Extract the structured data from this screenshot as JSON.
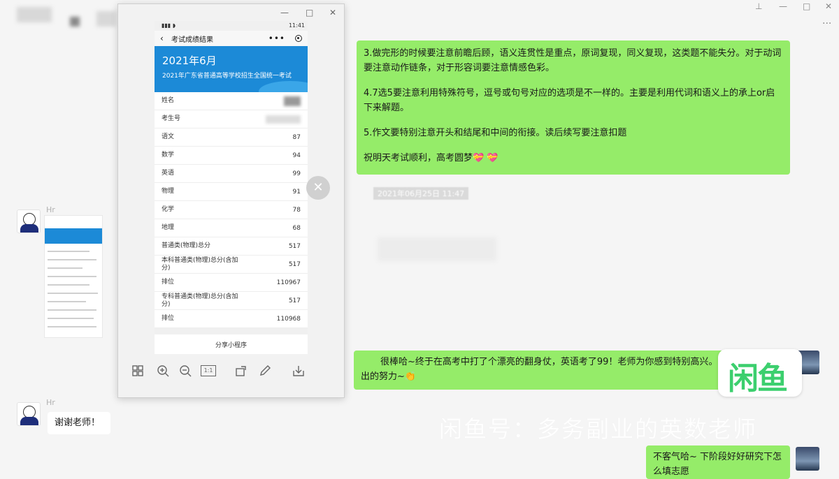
{
  "window": {
    "controls": [
      "—",
      "□",
      "✕"
    ]
  },
  "viewer": {
    "controls": [
      "—",
      "□",
      "✕"
    ],
    "phone": {
      "status_time": "11:41",
      "nav_title": "考试成绩结果",
      "banner_year": "2021年6月",
      "banner_subtitle": "2021年广东省普通高等学校招生全国统一考试",
      "rows": [
        {
          "label": "姓名",
          "value": ""
        },
        {
          "label": "考生号",
          "value": ""
        },
        {
          "label": "语文",
          "value": "87"
        },
        {
          "label": "数学",
          "value": "94"
        },
        {
          "label": "英语",
          "value": "99"
        },
        {
          "label": "物理",
          "value": "91"
        },
        {
          "label": "化学",
          "value": "78"
        },
        {
          "label": "地理",
          "value": "68"
        },
        {
          "label": "普通类(物理)总分",
          "value": "517"
        },
        {
          "label": "本科普通类(物理)总分(含加分)",
          "value": "517"
        },
        {
          "label": "排位",
          "value": "110967"
        },
        {
          "label": "专科普通类(物理)总分(含加分)",
          "value": "517"
        },
        {
          "label": "排位",
          "value": "110968"
        }
      ],
      "share_label": "分享小程序"
    },
    "toolbar_icons": [
      "grid-icon",
      "zoom-in-icon",
      "zoom-out-icon",
      "actual-size-icon",
      "rotate-icon",
      "edit-icon",
      "download-icon"
    ],
    "actual_size_label": "1:1",
    "close_glyph": "✕"
  },
  "chat": {
    "sender_name": "Hr",
    "teacher_message": [
      "3.做完形的时候要注意前瞻后顾，语义连贯性是重点，原词复现，同义复现，这类题不能失分。对于动词要注意动作链条，对于形容词要注意情感色彩。",
      "4.7选5要注意利用特殊符号，逗号或句号对应的选项是不一样的。主要是利用代词和语义上的承上or启下来解题。",
      "5.作文要特别注意开头和结尾和中间的衔接。读后续写要注意扣题",
      "祝明天考试顺利，高考圆梦💝 💝"
    ],
    "timestamp": "2021年06月25日 11:47",
    "congrats_message": "很棒哈~终于在高考中打了个漂亮的翻身仗，英语考了99！老师为你感到特别高兴。感谢你一起付出的努力~👏",
    "student_reply": "谢谢老师！",
    "teacher_reply": "不客气哈~ 下阶段好好研究下怎么填志愿"
  },
  "watermark": "闲鱼号：多务副业的英数老师",
  "logo_text": "闲鱼"
}
